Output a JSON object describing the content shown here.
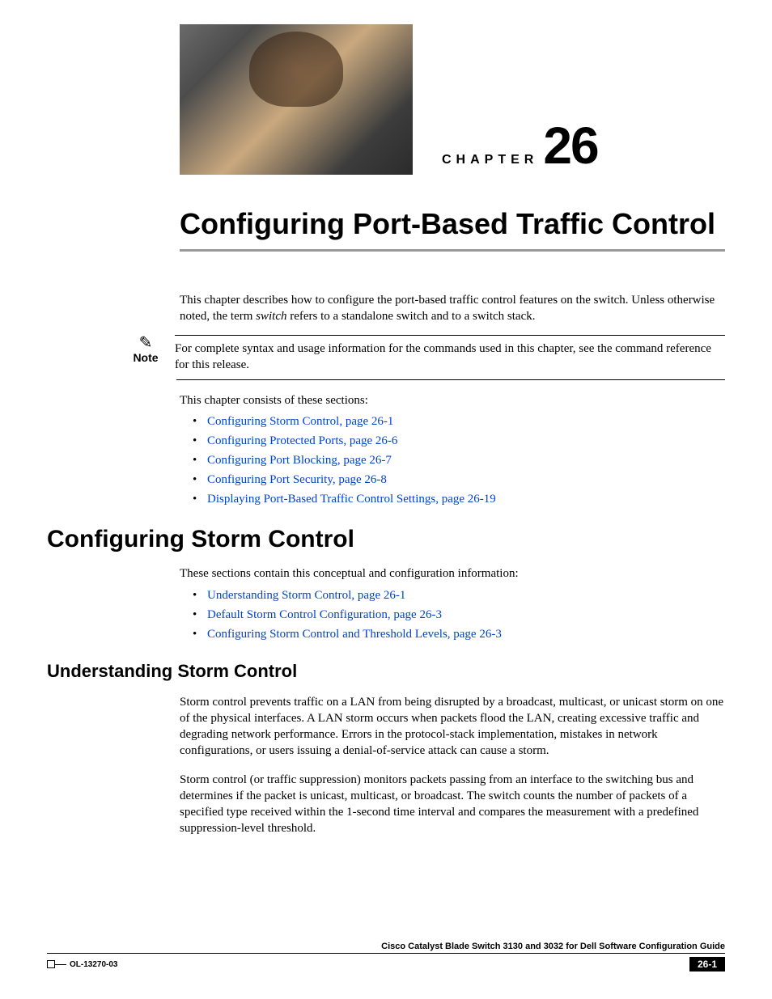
{
  "chapter": {
    "label": "CHAPTER",
    "number": "26",
    "title": "Configuring Port-Based Traffic Control"
  },
  "intro": {
    "para1_pre": "This chapter describes how to configure the port-based traffic control features on the switch. Unless otherwise noted, the term ",
    "para1_italic": "switch",
    "para1_post": " refers to a standalone switch and to a switch stack."
  },
  "note": {
    "label": "Note",
    "text": "For complete syntax and usage information for the commands used in this chapter, see the command reference for this release."
  },
  "sections_intro": "This chapter consists of these sections:",
  "toc": [
    "Configuring Storm Control, page 26-1",
    "Configuring Protected Ports, page 26-6",
    "Configuring Port Blocking, page 26-7",
    "Configuring Port Security, page 26-8",
    "Displaying Port-Based Traffic Control Settings, page 26-19"
  ],
  "storm": {
    "heading": "Configuring Storm Control",
    "intro": "These sections contain this conceptual and configuration information:",
    "links": [
      "Understanding Storm Control, page 26-1",
      "Default Storm Control Configuration, page 26-3",
      "Configuring Storm Control and Threshold Levels, page 26-3"
    ],
    "sub_heading": "Understanding Storm Control",
    "p1": "Storm control prevents traffic on a LAN from being disrupted by a broadcast, multicast, or unicast storm on one of the physical interfaces. A LAN storm occurs when packets flood the LAN, creating excessive traffic and degrading network performance. Errors in the protocol-stack implementation, mistakes in network configurations, or users issuing a denial-of-service attack can cause a storm.",
    "p2": "Storm control (or traffic suppression) monitors packets passing from an interface to the switching bus and determines if the packet is unicast, multicast, or broadcast. The switch counts the number of packets of a specified type received within the 1-second time interval and compares the measurement with a predefined suppression-level threshold."
  },
  "footer": {
    "guide_title": "Cisco Catalyst Blade Switch 3130 and 3032 for Dell Software Configuration Guide",
    "doc_id": "OL-13270-03",
    "page_num": "26-1"
  }
}
